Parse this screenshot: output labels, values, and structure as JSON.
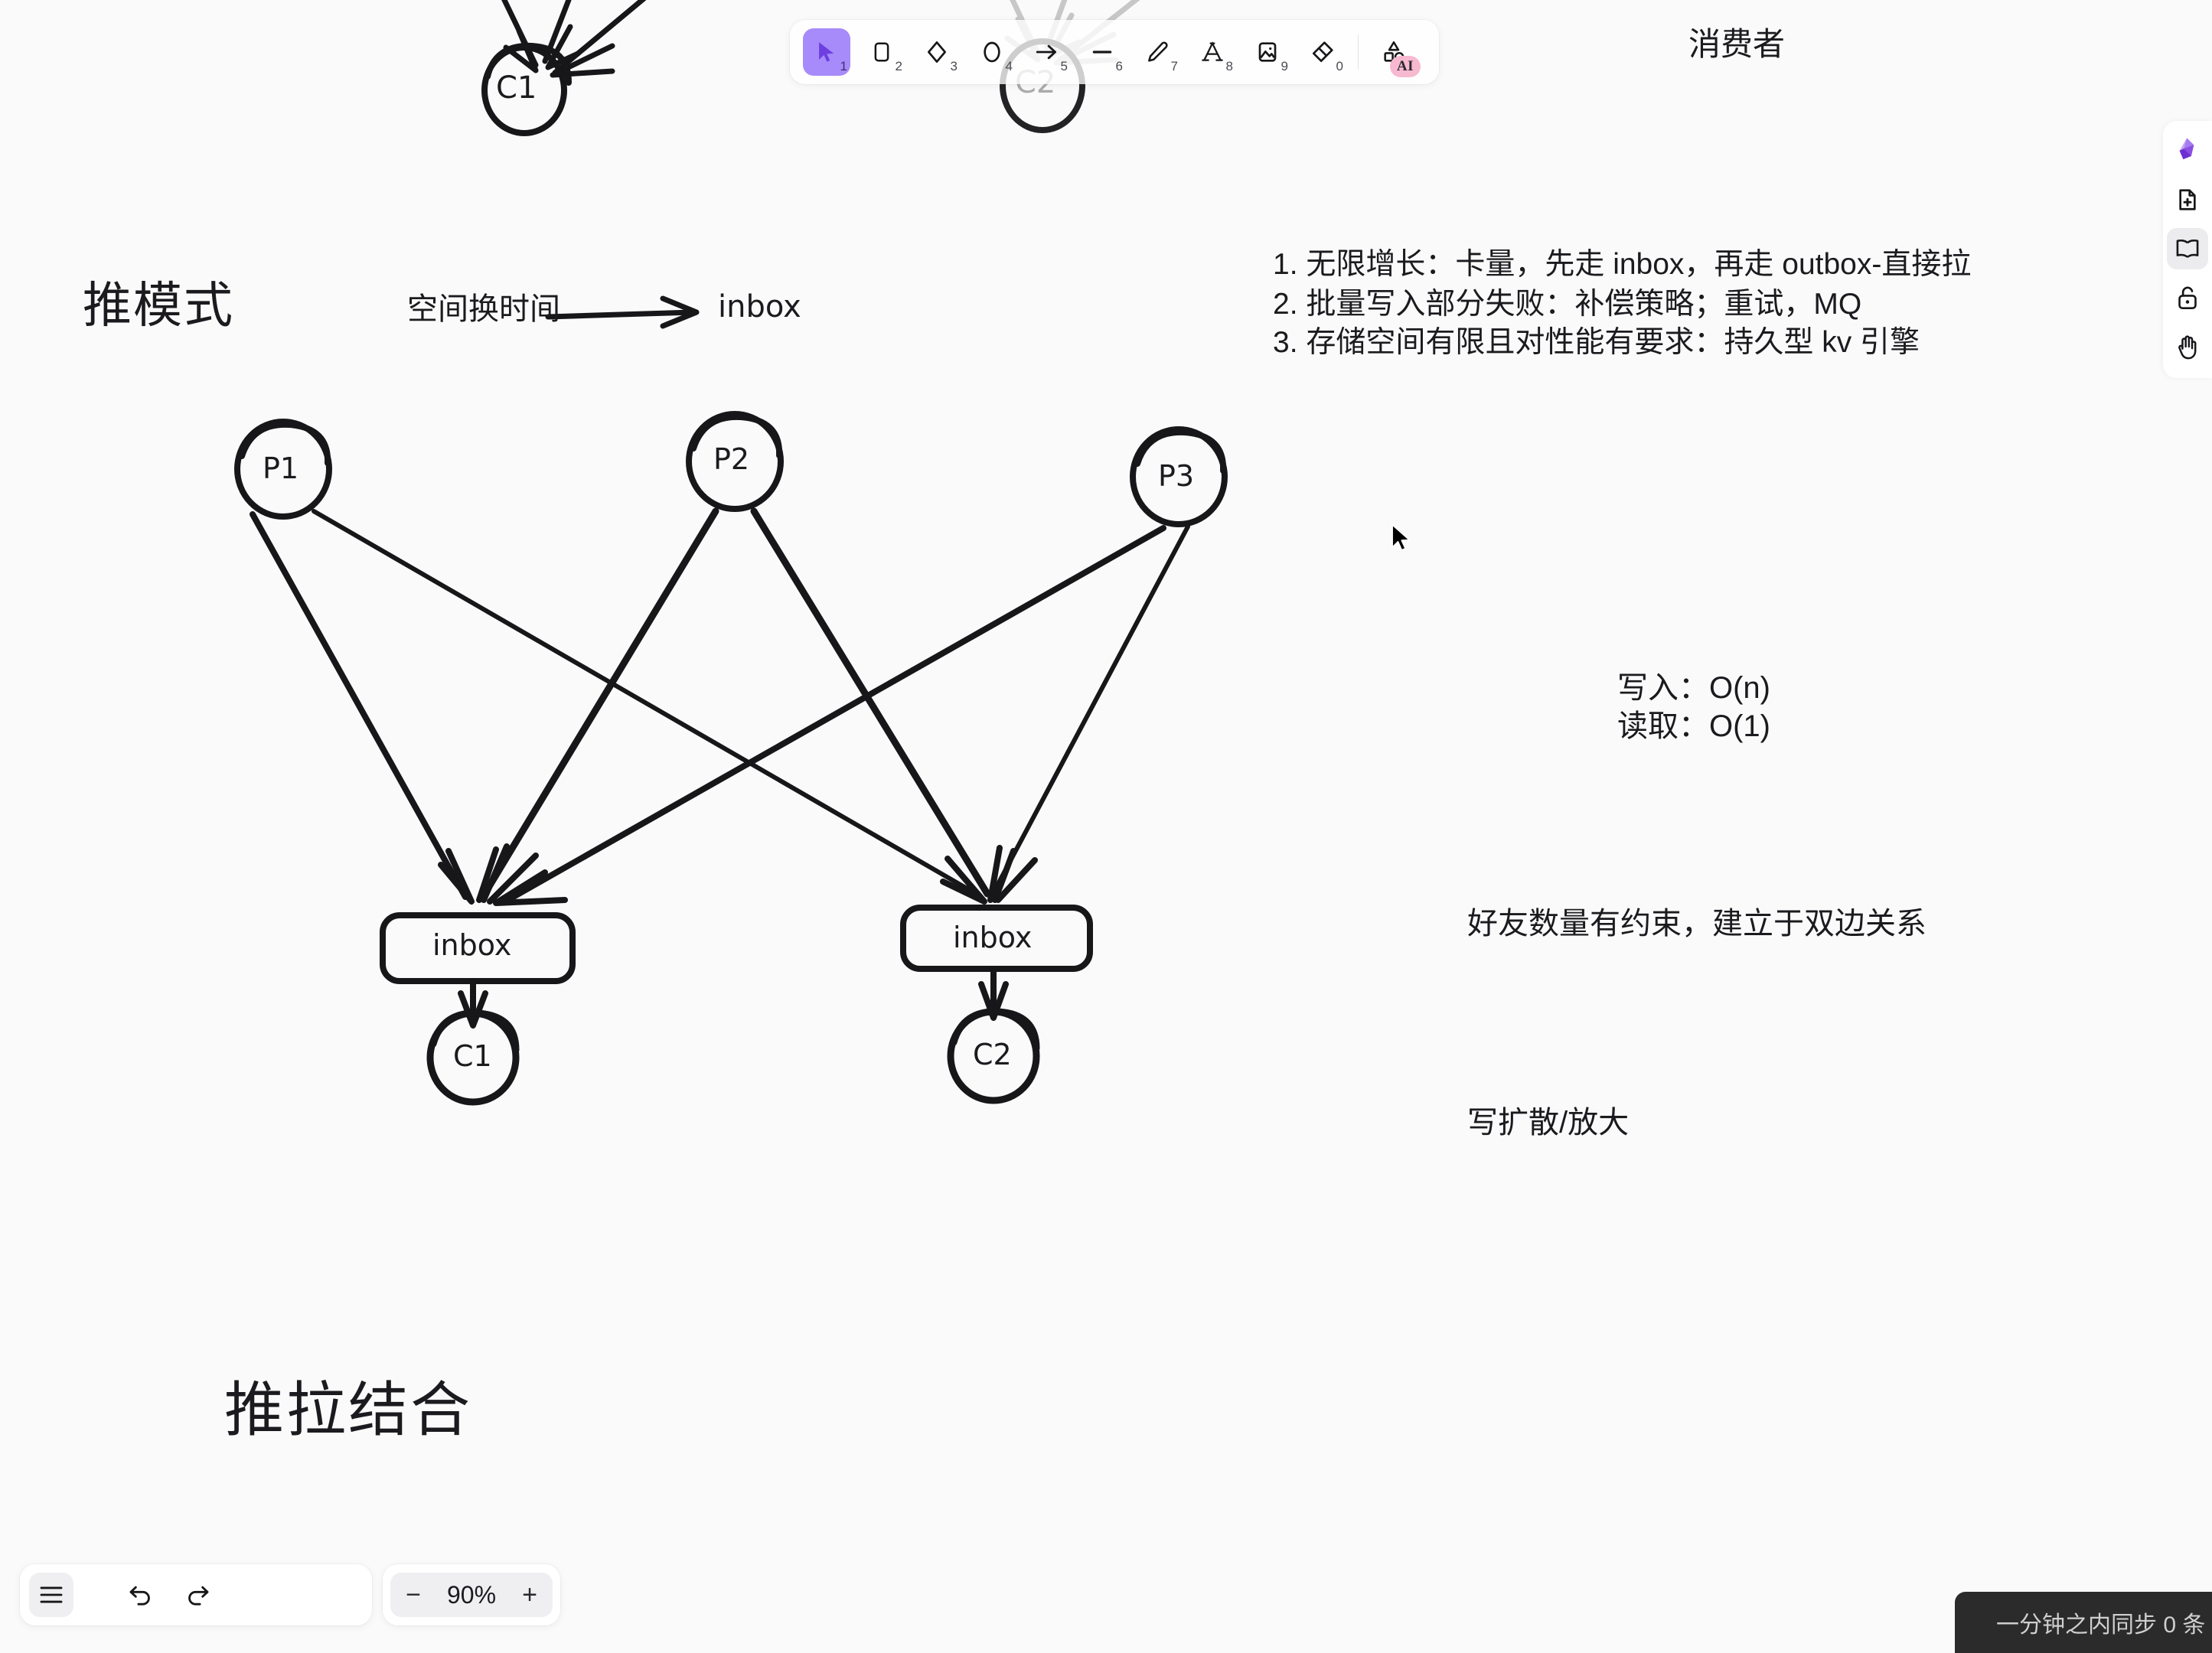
{
  "app": {
    "background": "#fafafa",
    "accent": "#a78bfa",
    "ai_badge_color": "#f7b9cf"
  },
  "toolbar": {
    "tools": [
      {
        "name": "select-tool",
        "icon": "cursor-icon",
        "shortcut": "1",
        "active": true
      },
      {
        "name": "rectangle-tool",
        "icon": "rectangle-icon",
        "shortcut": "2",
        "active": false
      },
      {
        "name": "diamond-tool",
        "icon": "diamond-icon",
        "shortcut": "3",
        "active": false
      },
      {
        "name": "ellipse-tool",
        "icon": "ellipse-icon",
        "shortcut": "4",
        "active": false
      },
      {
        "name": "arrow-tool",
        "icon": "arrow-icon",
        "shortcut": "5",
        "active": false
      },
      {
        "name": "line-tool",
        "icon": "line-icon",
        "shortcut": "6",
        "active": false
      },
      {
        "name": "pencil-tool",
        "icon": "pencil-icon",
        "shortcut": "7",
        "active": false
      },
      {
        "name": "text-tool",
        "icon": "text-a-icon",
        "shortcut": "8",
        "active": false
      },
      {
        "name": "image-tool",
        "icon": "image-icon",
        "shortcut": "9",
        "active": false
      },
      {
        "name": "eraser-tool",
        "icon": "eraser-icon",
        "shortcut": "0",
        "active": false
      }
    ],
    "ai_tool": {
      "name": "shapes-ai-tool",
      "icon": "shapes-icon",
      "badge": "AI"
    }
  },
  "right_rail": {
    "items": [
      {
        "name": "gem-logo",
        "icon": "gem-icon",
        "active": false
      },
      {
        "name": "new-file-button",
        "icon": "file-plus-icon",
        "active": false
      },
      {
        "name": "library-button",
        "icon": "book-icon",
        "active": true
      },
      {
        "name": "lock-button",
        "icon": "unlock-icon",
        "active": false
      },
      {
        "name": "hand-tool",
        "icon": "hand-icon",
        "active": false
      }
    ]
  },
  "bottom_bar": {
    "menu_label": "hamburger-menu",
    "undo_label": "undo",
    "redo_label": "redo",
    "zoom_out_label": "−",
    "zoom_level": "90%",
    "zoom_in_label": "+"
  },
  "status": {
    "sync_text": "一分钟之内同步   0  条"
  },
  "canvas": {
    "headings": {
      "push_mode": "推模式",
      "push_pull": "推拉结合"
    },
    "labels": {
      "consumer": "消费者",
      "space_for_time": "空间换时间",
      "inbox_arrow_target": "inbox"
    },
    "notes": {
      "line1": "1. 无限增长：卡量，先走 inbox，再走 outbox-直接拉",
      "line2": "2. 批量写入部分失败：补偿策略；重试，MQ",
      "line3": "3. 存储空间有限且对性能有要求：持久型 kv 引擎",
      "write_complexity": "写入：O(n)",
      "read_complexity": "读取：O(1)",
      "friends_constraint": "好友数量有约束，建立于双边关系",
      "write_fanout": "写扩散/放大"
    },
    "nodes": {
      "top_c1": "C1",
      "top_c2": "C2",
      "p1": "P1",
      "p2": "P2",
      "p3": "P3",
      "inbox_left": "inbox",
      "inbox_right": "inbox",
      "c1": "C1",
      "c2": "C2"
    }
  }
}
